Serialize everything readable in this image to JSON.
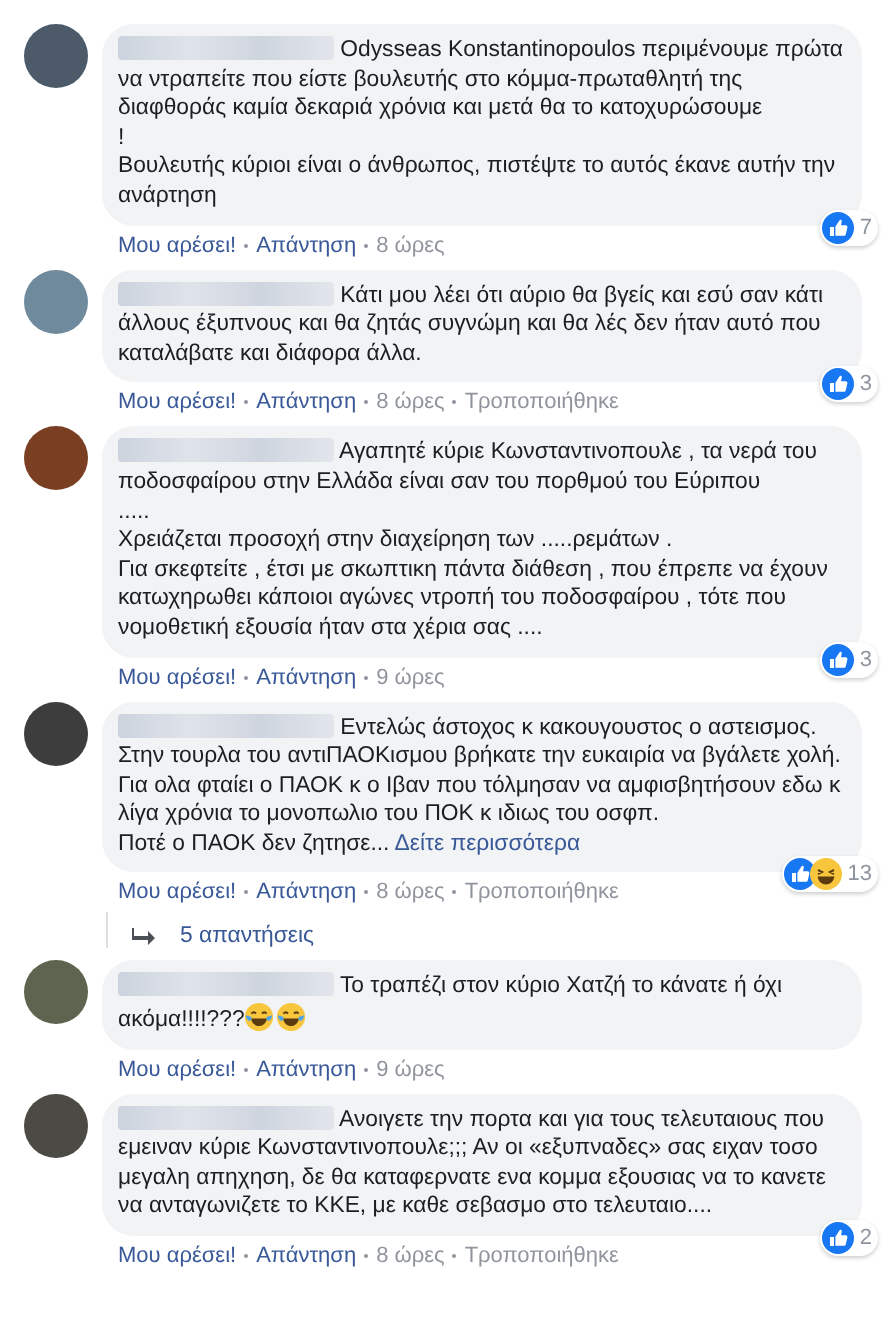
{
  "comments": [
    {
      "text": "Odysseas Konstantinopoulos περιμένουμε πρώτα να ντραπείτε που είστε βουλευτής στο κόμμα-πρωταθλητή της διαφθοράς καμία δεκαριά χρόνια και μετά θα το κατοχυρώσουμε\n!\nΒουλευτής κύριοι είναι ο άνθρωπος, πιστέψτε το αυτός έκανε αυτήν την ανάρτηση",
      "reactions": [
        {
          "kind": "like"
        }
      ],
      "reaction_count": "7",
      "actions": [
        "Μου αρέσει!",
        "Απάντηση"
      ],
      "time": "8 ώρες"
    },
    {
      "text": "Κάτι μου λέει ότι αύριο θα βγείς και εσύ σαν κάτι άλλους έξυπνους και θα ζητάς συγνώμη και θα λές δεν ήταν αυτό που καταλάβατε και διάφορα άλλα.",
      "reactions": [
        {
          "kind": "like"
        }
      ],
      "reaction_count": "3",
      "actions": [
        "Μου αρέσει!",
        "Απάντηση"
      ],
      "time": "8 ώρες",
      "edited": "Τροποποιήθηκε"
    },
    {
      "text": "Αγαπητέ κύριε Κωνσταντινοπουλε , τα νερά του ποδοσφαίρου στην Ελλάδα είναι σαν του πορθμού του Εύριπου\n.....\nΧρειάζεται προσοχή στην διαχείρηση των .....ρεμάτων .\nΓια σκεφτείτε , έτσι με σκωπτικη πάντα διάθεση , που έπρεπε να έχουν κατωχηρωθει κάποιοι αγώνες ντροπή του ποδοσφαίρου , τότε που νομοθετική εξουσία ήταν στα χέρια σας ....",
      "reactions": [
        {
          "kind": "like"
        }
      ],
      "reaction_count": "3",
      "actions": [
        "Μου αρέσει!",
        "Απάντηση"
      ],
      "time": "9 ώρες"
    },
    {
      "text": "Εντελώς άστοχος κ κακουγουστος ο αστεισμος.\nΣτην τουρλα του αντιΠΑΟΚισμου βρήκατε την ευκαιρία να βγάλετε χολή. Για ολα φταίει ο ΠΑΟΚ κ ο Ιβαν που τόλμησαν να αμφισβητήσουν εδω κ λίγα χρόνια το μονοπωλιο του ΠΟΚ κ ιδιως του οσφπ.\nΠοτέ ο ΠΑΟΚ δεν ζητησε...",
      "see_more": "Δείτε περισσότερα",
      "reactions": [
        {
          "kind": "like"
        },
        {
          "kind": "haha"
        }
      ],
      "reaction_count": "13",
      "actions": [
        "Μου αρέσει!",
        "Απάντηση"
      ],
      "time": "8 ώρες",
      "edited": "Τροποποιήθηκε",
      "replies": "5 απαντήσεις"
    },
    {
      "text": "Το τραπέζι στον κύριο Χατζή το κάνατε ή όχι ακόμα!!!!???",
      "emojis": [
        {
          "kind": "laugh"
        },
        {
          "kind": "laugh"
        }
      ],
      "actions": [
        "Μου αρέσει!",
        "Απάντηση"
      ],
      "time": "9 ώρες"
    },
    {
      "text": "Ανοιγετε την πορτα και για τους τελευταιους που εμειναν κύριε Κωνσταντινοπουλε;;; Αν οι «εξυπναδες» σας ειχαν τοσο μεγαλη απηχηση, δε θα καταφερνατε ενα κομμα εξουσιας να το κανετε να ανταγωνιζετε το ΚΚΕ, με καθε σεβασμο στο τελευταιο....",
      "reactions": [
        {
          "kind": "like"
        }
      ],
      "reaction_count": "2",
      "actions": [
        "Μου αρέσει!",
        "Απάντηση"
      ],
      "time": "8 ώρες",
      "edited": "Τροποποιήθηκε"
    }
  ]
}
